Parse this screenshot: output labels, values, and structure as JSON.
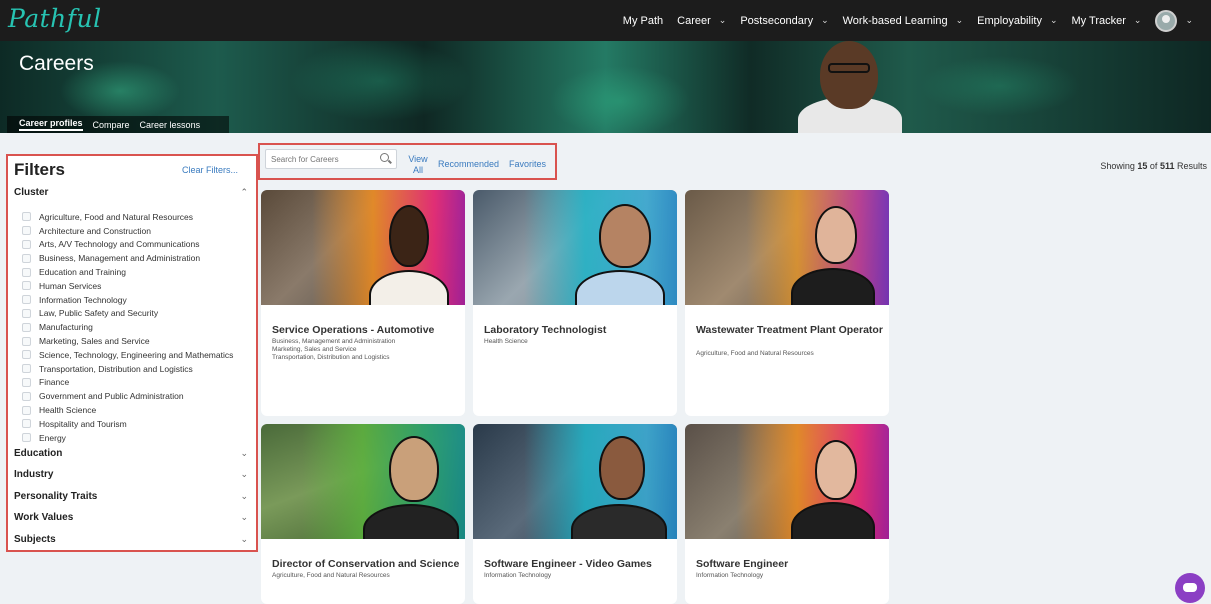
{
  "app": {
    "logo": "Pathful"
  },
  "nav": {
    "items": [
      {
        "label": "My Path",
        "dropdown": false
      },
      {
        "label": "Career",
        "dropdown": true
      },
      {
        "label": "Postsecondary",
        "dropdown": true
      },
      {
        "label": "Work-based Learning",
        "dropdown": true
      },
      {
        "label": "Employability",
        "dropdown": true
      },
      {
        "label": "My Tracker",
        "dropdown": true
      }
    ]
  },
  "banner": {
    "title": "Careers",
    "tabs": [
      {
        "label": "Career profiles",
        "active": true
      },
      {
        "label": "Compare",
        "active": false
      },
      {
        "label": "Career lessons",
        "active": false
      }
    ]
  },
  "filters": {
    "title": "Filters",
    "clear_label": "Clear Filters...",
    "cluster": {
      "label": "Cluster",
      "items": [
        "Agriculture, Food and Natural Resources",
        "Architecture and Construction",
        "Arts, A/V Technology and Communications",
        "Business, Management and Administration",
        "Education and Training",
        "Human Services",
        "Information Technology",
        "Law, Public Safety and Security",
        "Manufacturing",
        "Marketing, Sales and Service",
        "Science, Technology, Engineering and Mathematics",
        "Transportation, Distribution and Logistics",
        "Finance",
        "Government and Public Administration",
        "Health Science",
        "Hospitality and Tourism",
        "Energy"
      ]
    },
    "sections": [
      "Education",
      "Industry",
      "Personality Traits",
      "Work Values",
      "Subjects"
    ]
  },
  "search": {
    "placeholder": "Search for Careers",
    "view_all": "View All",
    "recommended": "Recommended",
    "favorites": "Favorites"
  },
  "results": {
    "prefix": "Showing",
    "shown": "15",
    "of": "of",
    "total": "511",
    "suffix": "Results"
  },
  "cards": [
    {
      "title": "Service Operations - Automotive",
      "clusters": [
        "Business, Management and Administration",
        "Marketing, Sales and Service",
        "Transportation, Distribution and Logistics"
      ]
    },
    {
      "title": "Laboratory Technologist",
      "clusters": [
        "Health Science"
      ]
    },
    {
      "title": "Wastewater Treatment Plant Operator",
      "clusters": [
        "Agriculture, Food and Natural Resources"
      ]
    },
    {
      "title": "Director of Conservation and Science",
      "clusters": [
        "Agriculture, Food and Natural Resources"
      ]
    },
    {
      "title": "Software Engineer - Video Games",
      "clusters": [
        "Information Technology"
      ]
    },
    {
      "title": "Software Engineer",
      "clusters": [
        "Information Technology"
      ]
    }
  ],
  "colors": {
    "accent": "#3a7bbf",
    "highlight_border": "#d9534f",
    "logo": "#27c3b2",
    "chat": "#8b3fc4"
  }
}
